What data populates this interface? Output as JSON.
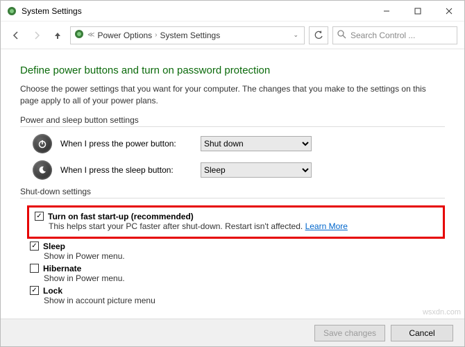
{
  "window": {
    "title": "System Settings"
  },
  "breadcrumb": {
    "item1": "Power Options",
    "item2": "System Settings"
  },
  "search": {
    "placeholder": "Search Control ..."
  },
  "page": {
    "heading": "Define power buttons and turn on password protection",
    "description": "Choose the power settings that you want for your computer. The changes that you make to the settings on this page apply to all of your power plans."
  },
  "section_power_sleep": {
    "title": "Power and sleep button settings",
    "power_button_label": "When I press the power button:",
    "power_button_value": "Shut down",
    "sleep_button_label": "When I press the sleep button:",
    "sleep_button_value": "Sleep"
  },
  "section_shutdown": {
    "title": "Shut-down settings",
    "fast_startup": {
      "checked": true,
      "label": "Turn on fast start-up (recommended)",
      "sub": "This helps start your PC faster after shut-down. Restart isn't affected. ",
      "link": "Learn More"
    },
    "sleep": {
      "checked": true,
      "label": "Sleep",
      "sub": "Show in Power menu."
    },
    "hibernate": {
      "checked": false,
      "label": "Hibernate",
      "sub": "Show in Power menu."
    },
    "lock": {
      "checked": true,
      "label": "Lock",
      "sub": "Show in account picture menu"
    }
  },
  "footer": {
    "save": "Save changes",
    "cancel": "Cancel"
  },
  "watermark": "wsxdn.com"
}
